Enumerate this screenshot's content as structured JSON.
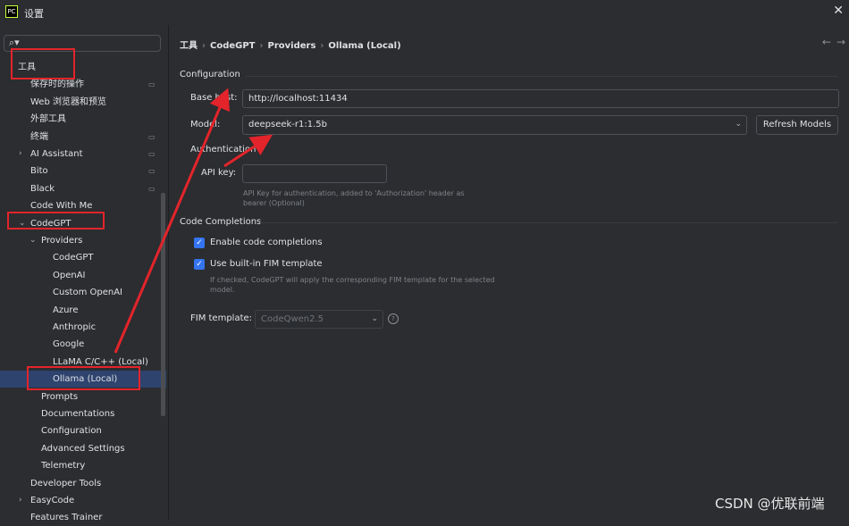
{
  "window": {
    "app_icon_text": "PC",
    "title": "设置",
    "close_glyph": "✕"
  },
  "search": {
    "icon_glyph": "⌕▾"
  },
  "tree": [
    {
      "label": "工具",
      "indent": 0,
      "arrow": "",
      "ext": false,
      "selected": false
    },
    {
      "label": "保存时的操作",
      "indent": 1,
      "arrow": "",
      "ext": true,
      "selected": false
    },
    {
      "label": "Web 浏览器和预览",
      "indent": 1,
      "arrow": "",
      "ext": false,
      "selected": false
    },
    {
      "label": "外部工具",
      "indent": 1,
      "arrow": "",
      "ext": false,
      "selected": false
    },
    {
      "label": "终端",
      "indent": 1,
      "arrow": "",
      "ext": true,
      "selected": false
    },
    {
      "label": "AI Assistant",
      "indent": 1,
      "arrow": "›",
      "ext": true,
      "selected": false
    },
    {
      "label": "Bito",
      "indent": 1,
      "arrow": "",
      "ext": true,
      "selected": false
    },
    {
      "label": "Black",
      "indent": 1,
      "arrow": "",
      "ext": true,
      "selected": false
    },
    {
      "label": "Code With Me",
      "indent": 1,
      "arrow": "",
      "ext": false,
      "selected": false
    },
    {
      "label": "CodeGPT",
      "indent": 1,
      "arrow": "⌄",
      "ext": false,
      "selected": false
    },
    {
      "label": "Providers",
      "indent": 2,
      "arrow": "⌄",
      "ext": false,
      "selected": false
    },
    {
      "label": "CodeGPT",
      "indent": 3,
      "arrow": "",
      "ext": false,
      "selected": false
    },
    {
      "label": "OpenAI",
      "indent": 3,
      "arrow": "",
      "ext": false,
      "selected": false
    },
    {
      "label": "Custom OpenAI",
      "indent": 3,
      "arrow": "",
      "ext": false,
      "selected": false
    },
    {
      "label": "Azure",
      "indent": 3,
      "arrow": "",
      "ext": false,
      "selected": false
    },
    {
      "label": "Anthropic",
      "indent": 3,
      "arrow": "",
      "ext": false,
      "selected": false
    },
    {
      "label": "Google",
      "indent": 3,
      "arrow": "",
      "ext": false,
      "selected": false
    },
    {
      "label": "LLaMA C/C++ (Local)",
      "indent": 3,
      "arrow": "",
      "ext": false,
      "selected": false
    },
    {
      "label": "Ollama (Local)",
      "indent": 3,
      "arrow": "",
      "ext": false,
      "selected": true
    },
    {
      "label": "Prompts",
      "indent": 2,
      "arrow": "",
      "ext": false,
      "selected": false
    },
    {
      "label": "Documentations",
      "indent": 2,
      "arrow": "",
      "ext": false,
      "selected": false
    },
    {
      "label": "Configuration",
      "indent": 2,
      "arrow": "",
      "ext": false,
      "selected": false
    },
    {
      "label": "Advanced Settings",
      "indent": 2,
      "arrow": "",
      "ext": false,
      "selected": false
    },
    {
      "label": "Telemetry",
      "indent": 2,
      "arrow": "",
      "ext": false,
      "selected": false
    },
    {
      "label": "Developer Tools",
      "indent": 1,
      "arrow": "",
      "ext": false,
      "selected": false
    },
    {
      "label": "EasyCode",
      "indent": 1,
      "arrow": "›",
      "ext": false,
      "selected": false
    },
    {
      "label": "Features Trainer",
      "indent": 1,
      "arrow": "",
      "ext": false,
      "selected": false
    }
  ],
  "breadcrumb": {
    "items": [
      "工具",
      "CodeGPT",
      "Providers",
      "Ollama (Local)"
    ],
    "separator": "›"
  },
  "nav": {
    "back": "←",
    "forward": "→"
  },
  "configuration": {
    "section_title": "Configuration",
    "base_host_label": "Base host:",
    "base_host_value": "http://localhost:11434",
    "model_label": "Model:",
    "model_value": "deepseek-r1:1.5b",
    "refresh_button": "Refresh Models",
    "auth_title": "Authentication",
    "api_key_label": "API key:",
    "api_key_value": "",
    "api_key_help_1": "API Key for authentication, added to 'Authorization' header as",
    "api_key_help_2": "bearer (Optional)"
  },
  "completions": {
    "section_title": "Code Completions",
    "enable_label": "Enable code completions",
    "enable_checked": true,
    "fim_label": "Use built-in FIM template",
    "fim_checked": true,
    "fim_help_1": "If checked, CodeGPT will apply the corresponding FIM template for the selected",
    "fim_help_2": "model.",
    "fim_template_label": "FIM template:",
    "fim_template_value": "CodeQwen2.5"
  },
  "icons": {
    "check": "✓",
    "question": "?",
    "chevron_down": "⌄"
  },
  "annotation_color": "#e3242b",
  "selection_color": "#2e436e",
  "watermark": "CSDN @优联前端"
}
